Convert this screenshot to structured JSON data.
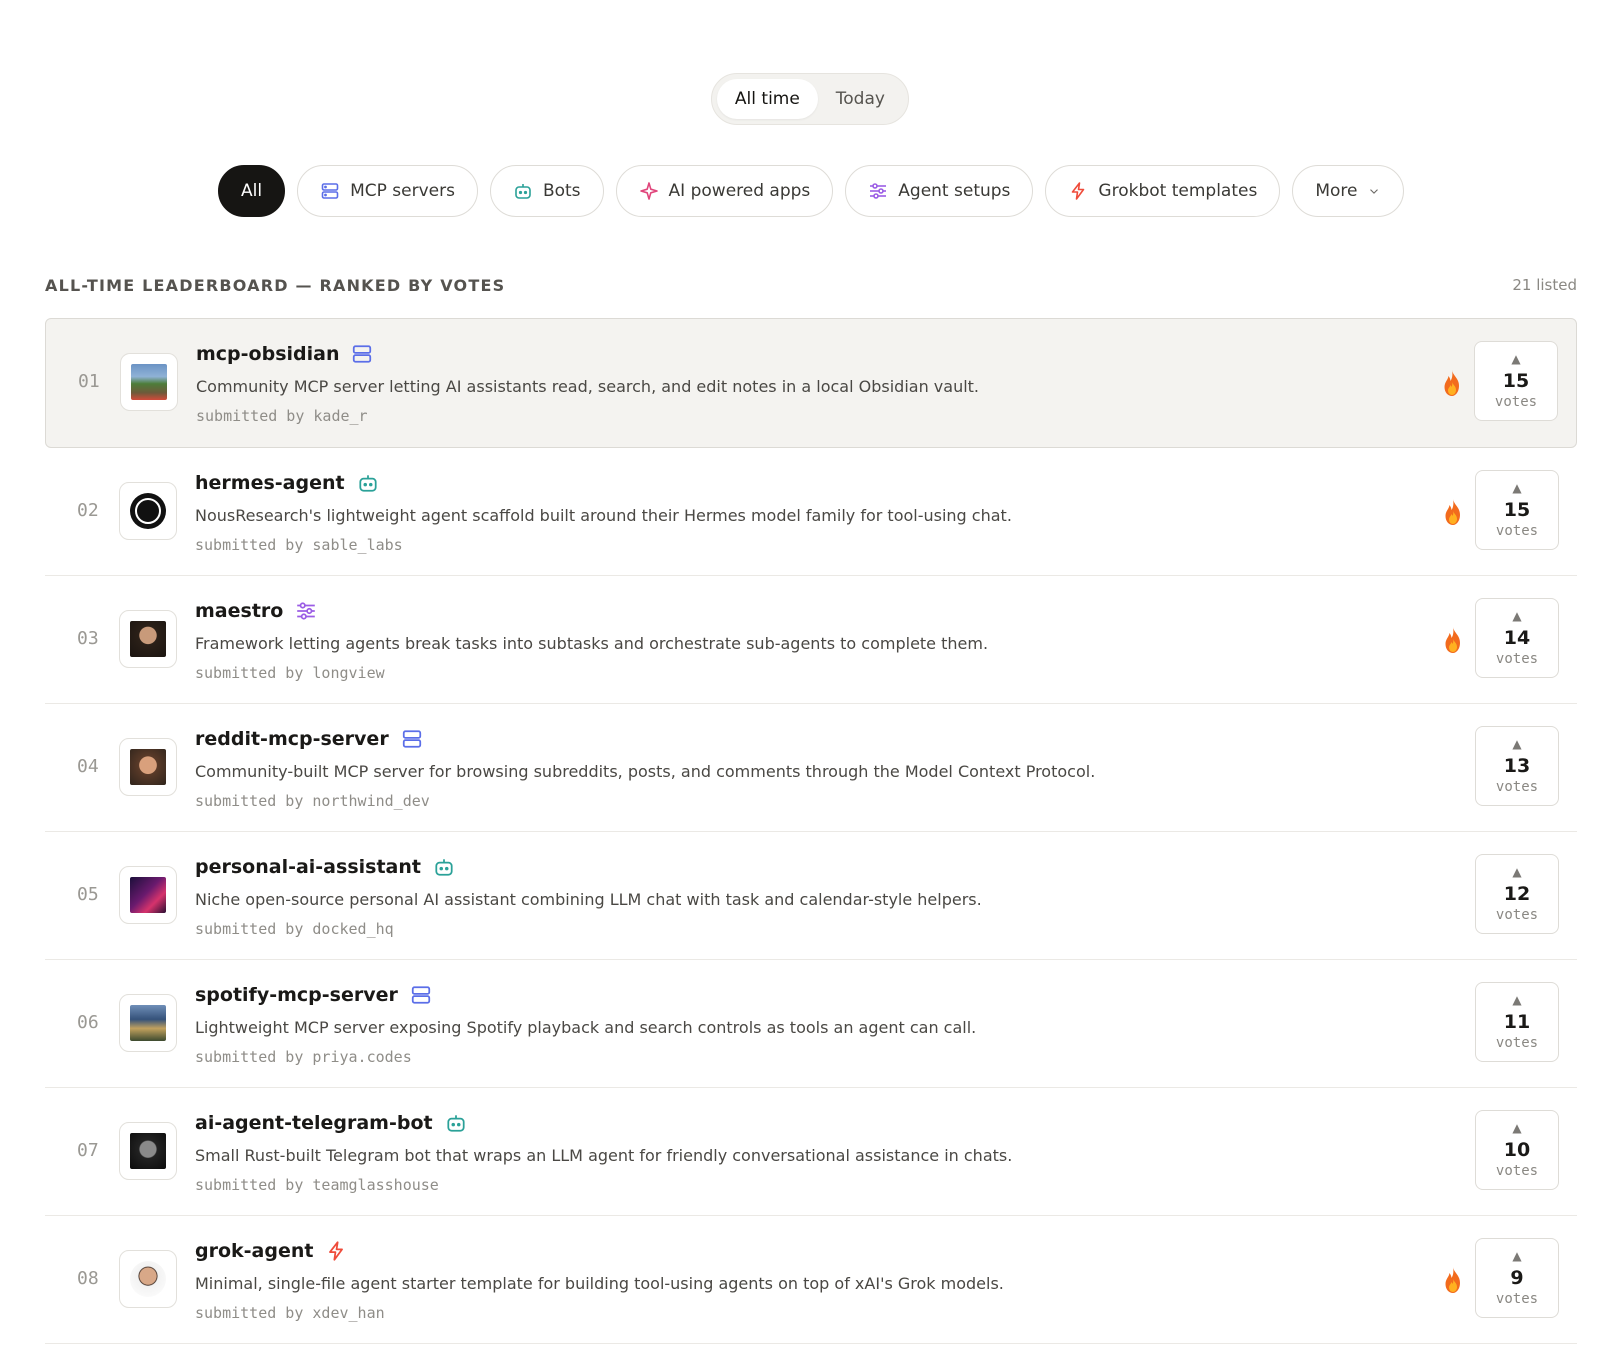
{
  "time_filter": {
    "options": [
      "All time",
      "Today"
    ],
    "selected": "All time"
  },
  "filters": [
    {
      "label": "All",
      "icon": "none",
      "active": true
    },
    {
      "label": "MCP servers",
      "icon": "server-icon"
    },
    {
      "label": "Bots",
      "icon": "bot-icon"
    },
    {
      "label": "AI powered apps",
      "icon": "sparkle-icon"
    },
    {
      "label": "Agent setups",
      "icon": "sliders-icon"
    },
    {
      "label": "Grokbot templates",
      "icon": "bolt-icon"
    },
    {
      "label": "More",
      "icon": "chevron-down-icon"
    }
  ],
  "leaderboard": {
    "title": "ALL-TIME LEADERBOARD — RANKED BY VOTES",
    "count": "21 listed",
    "items": [
      {
        "rank": "01",
        "name": "mcp-obsidian",
        "category": "server-icon",
        "description": "Community MCP server letting AI assistants read, search, and edit notes in a local Obsidian vault.",
        "submitted_by": "submitted by kade_r",
        "votes": "15",
        "votes_label": "votes",
        "hot": true
      },
      {
        "rank": "02",
        "name": "hermes-agent",
        "category": "bot-icon",
        "description": "NousResearch's lightweight agent scaffold built around their Hermes model family for tool-using chat.",
        "submitted_by": "submitted by sable_labs",
        "votes": "15",
        "votes_label": "votes",
        "hot": true
      },
      {
        "rank": "03",
        "name": "maestro",
        "category": "sliders-icon",
        "description": "Framework letting agents break tasks into subtasks and orchestrate sub-agents to complete them.",
        "submitted_by": "submitted by longview",
        "votes": "14",
        "votes_label": "votes",
        "hot": true
      },
      {
        "rank": "04",
        "name": "reddit-mcp-server",
        "category": "server-icon",
        "description": "Community-built MCP server for browsing subreddits, posts, and comments through the Model Context Protocol.",
        "submitted_by": "submitted by northwind_dev",
        "votes": "13",
        "votes_label": "votes",
        "hot": false
      },
      {
        "rank": "05",
        "name": "personal-ai-assistant",
        "category": "bot-icon",
        "description": "Niche open-source personal AI assistant combining LLM chat with task and calendar-style helpers.",
        "submitted_by": "submitted by docked_hq",
        "votes": "12",
        "votes_label": "votes",
        "hot": false
      },
      {
        "rank": "06",
        "name": "spotify-mcp-server",
        "category": "server-icon",
        "description": "Lightweight MCP server exposing Spotify playback and search controls as tools an agent can call.",
        "submitted_by": "submitted by priya.codes",
        "votes": "11",
        "votes_label": "votes",
        "hot": false
      },
      {
        "rank": "07",
        "name": "ai-agent-telegram-bot",
        "category": "bot-icon",
        "description": "Small Rust-built Telegram bot that wraps an LLM agent for friendly conversational assistance in chats.",
        "submitted_by": "submitted by teamglasshouse",
        "votes": "10",
        "votes_label": "votes",
        "hot": false
      },
      {
        "rank": "08",
        "name": "grok-agent",
        "category": "bolt-icon",
        "description": "Minimal, single-file agent starter template for building tool-using agents on top of xAI's Grok models.",
        "submitted_by": "submitted by xdev_han",
        "votes": "9",
        "votes_label": "votes",
        "hot": true
      }
    ]
  },
  "colors": {
    "server": "#5b6ee8",
    "bot": "#2aa198",
    "sparkle": "#e0457b",
    "sliders": "#9b5de5",
    "bolt": "#ef4b3a",
    "fire": "#f26b1d"
  }
}
